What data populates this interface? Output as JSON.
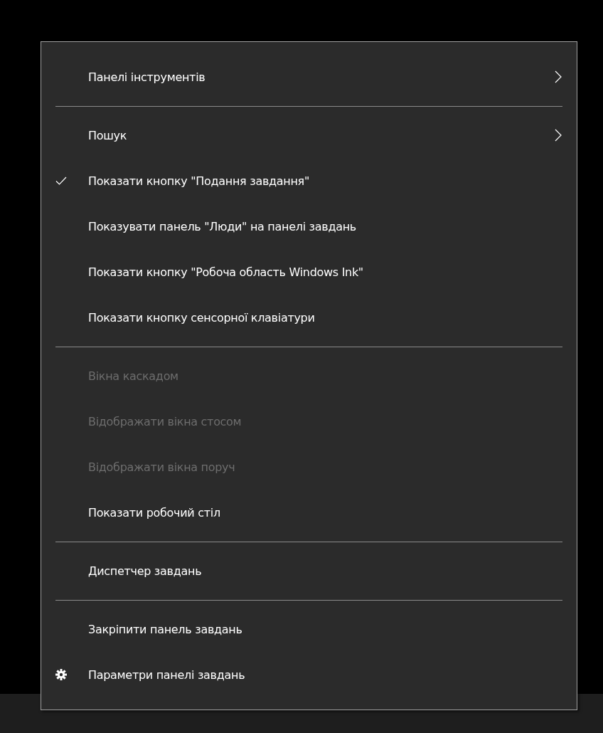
{
  "context_menu": {
    "items": [
      {
        "kind": "submenu",
        "label": "Панелі інструментів",
        "checked": false,
        "disabled": false
      },
      {
        "kind": "separator"
      },
      {
        "kind": "submenu",
        "label": "Пошук",
        "checked": false,
        "disabled": false
      },
      {
        "kind": "item",
        "label": "Показати кнопку \"Подання завдання\"",
        "checked": true,
        "disabled": false
      },
      {
        "kind": "item",
        "label": "Показувати панель \"Люди\" на панелі завдань",
        "checked": false,
        "disabled": false
      },
      {
        "kind": "item",
        "label": "Показати кнопку \"Робоча область Windows Ink\"",
        "checked": false,
        "disabled": false
      },
      {
        "kind": "item",
        "label": "Показати кнопку сенсорної клавіатури",
        "checked": false,
        "disabled": false
      },
      {
        "kind": "separator"
      },
      {
        "kind": "item",
        "label": "Вікна каскадом",
        "checked": false,
        "disabled": true
      },
      {
        "kind": "item",
        "label": "Відображати вікна стосом",
        "checked": false,
        "disabled": true
      },
      {
        "kind": "item",
        "label": "Відображати вікна поруч",
        "checked": false,
        "disabled": true
      },
      {
        "kind": "item",
        "label": "Показати робочий стіл",
        "checked": false,
        "disabled": false
      },
      {
        "kind": "separator"
      },
      {
        "kind": "item",
        "label": "Диспетчер завдань",
        "checked": false,
        "disabled": false
      },
      {
        "kind": "separator"
      },
      {
        "kind": "item",
        "label": "Закріпити панель завдань",
        "checked": false,
        "disabled": false
      },
      {
        "kind": "settings",
        "label": "Параметри панелі завдань",
        "checked": false,
        "disabled": false
      }
    ]
  }
}
